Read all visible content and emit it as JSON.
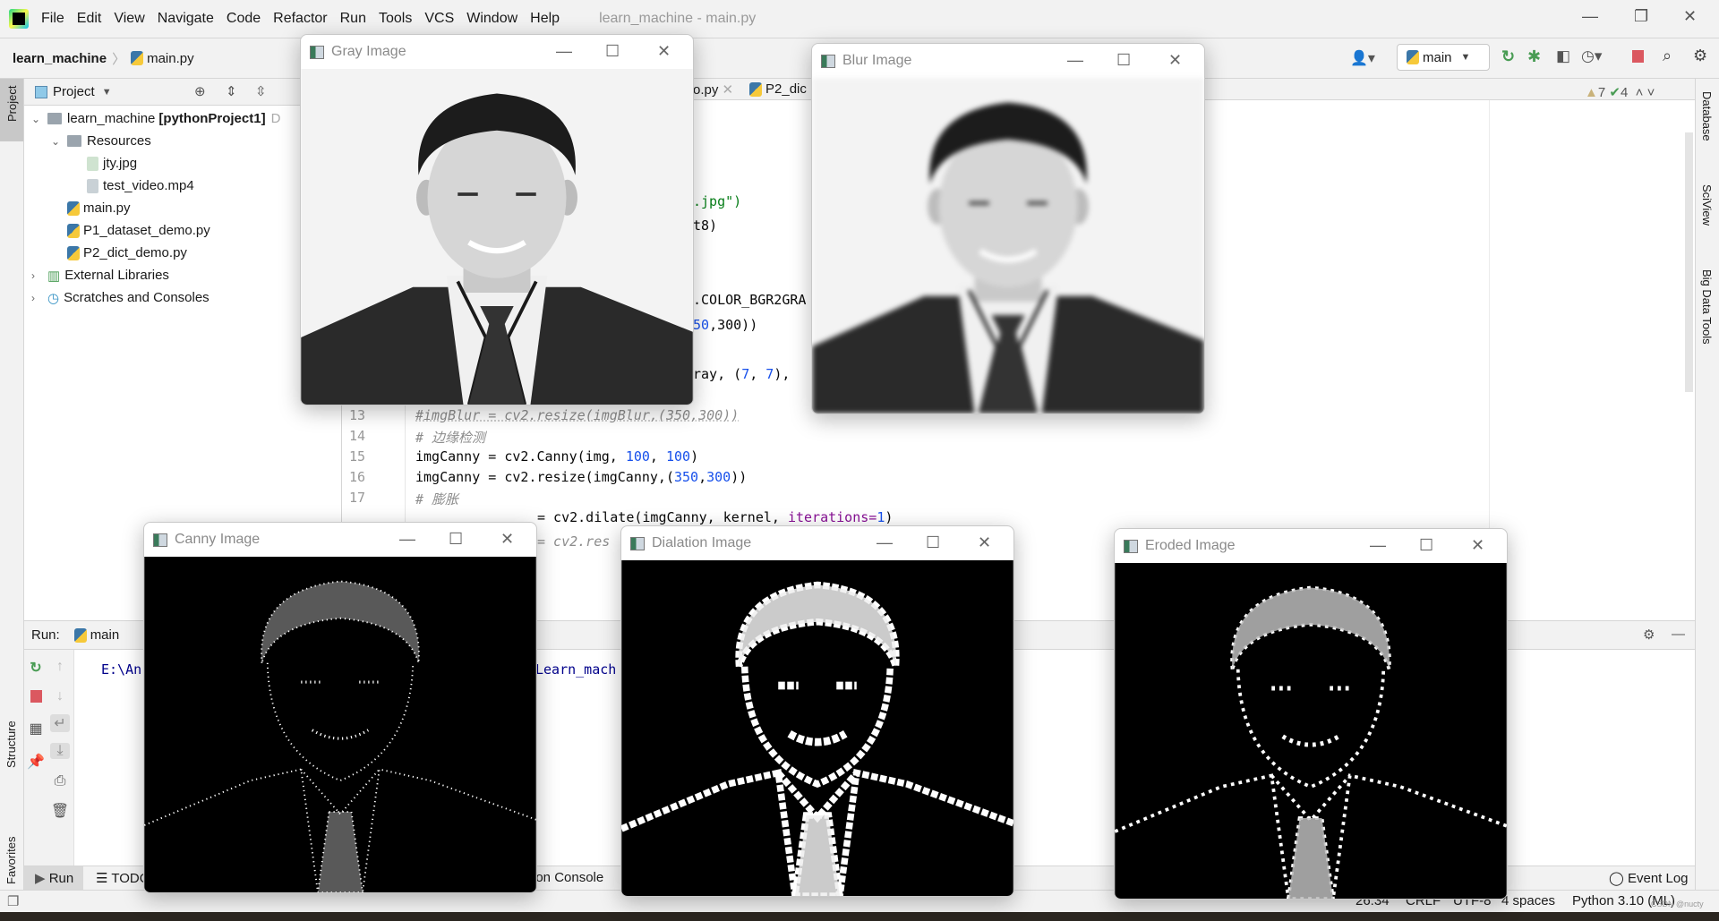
{
  "app": {
    "menu": [
      "File",
      "Edit",
      "View",
      "Navigate",
      "Code",
      "Refactor",
      "Run",
      "Tools",
      "VCS",
      "Window",
      "Help"
    ],
    "window_title": "learn_machine - main.py"
  },
  "nav": {
    "project": "learn_machine",
    "file": "main.py",
    "run_config": "main"
  },
  "project_panel": {
    "title": "Project",
    "tree": [
      {
        "label": "learn_machine",
        "suffix": "[pythonProject1]",
        "trail": "D",
        "type": "folder",
        "depth": 0,
        "expanded": true
      },
      {
        "label": "Resources",
        "type": "folder",
        "depth": 1,
        "expanded": true
      },
      {
        "label": "jty.jpg",
        "type": "image",
        "depth": 2
      },
      {
        "label": "test_video.mp4",
        "type": "unknown",
        "depth": 2
      },
      {
        "label": "main.py",
        "type": "python",
        "depth": 1
      },
      {
        "label": "P1_dataset_demo.py",
        "type": "python",
        "depth": 1
      },
      {
        "label": "P2_dict_demo.py",
        "type": "python",
        "depth": 1
      },
      {
        "label": "External Libraries",
        "type": "library",
        "depth": 0,
        "expanded": false
      },
      {
        "label": "Scratches and Consoles",
        "type": "scratch",
        "depth": 0,
        "expanded": false
      }
    ]
  },
  "editor": {
    "tabs": [
      {
        "label": "o.py"
      },
      {
        "label": "P2_dic"
      }
    ],
    "warnings": "7",
    "checks": "4",
    "fragments": {
      "l5": ".jpg\")",
      "l6": "t8)",
      "l9": ".COLOR_BGR2GRA",
      "l10a": "50",
      "l10b": ",300))",
      "l12a": "ray, (",
      "l12b": "7",
      ", ": ", ",
      "l12c": "7",
      "l12d": "), "
    },
    "line_numbers": [
      "13",
      "14",
      "15",
      "16",
      "17"
    ],
    "lines": {
      "l13": "#imgBlur = cv2.resize(imgBlur,(350,300))",
      "l14": "# 边缘检测",
      "l15a": "imgCanny = cv2.Canny(img, ",
      "l15b": "100",
      ", ": ", ",
      "l15c": "100",
      "l15d": ")",
      "l16a": "imgCanny = cv2.resize(imgCanny,(",
      "l16b": "350",
      "l16c": ",",
      "l16d": "300",
      "l16e": "))",
      "l17": "# 膨胀",
      "l18a": "= cv2.dilate(imgCanny, kernel, ",
      "l18b": "iterations=",
      "l18c": "1",
      ")": ")",
      "l19": "= cv2.res"
    }
  },
  "run": {
    "label": "Run:",
    "tab": "main",
    "console_a": "E:\\An",
    "console_b": "Learn_mach"
  },
  "bottom_tabs": {
    "run": "Run",
    "todo": "TODO",
    "python_console": "hon Console",
    "event_log": "Event Log"
  },
  "side": {
    "left": [
      "Project",
      "Structure",
      "Favorites"
    ],
    "right": [
      "Database",
      "SciView",
      "Big Data Tools"
    ]
  },
  "status": {
    "position": "26:34",
    "line_sep": "CRLF",
    "encoding": "UTF-8",
    "indent": "4 spaces",
    "interpreter": "Python 3.10 (ML)",
    "watermark": "CSDN @nucty"
  },
  "windows": [
    {
      "title": "Gray Image",
      "style": "gray"
    },
    {
      "title": "Blur Image",
      "style": "blur"
    },
    {
      "title": "Canny Image",
      "style": "canny"
    },
    {
      "title": "Dialation Image",
      "style": "dilate"
    },
    {
      "title": "Eroded Image",
      "style": "erode"
    }
  ],
  "colors": {
    "run_green": "#499c54",
    "stop_red": "#db5860",
    "keyword_blue": "#1750eb",
    "comment": "#8c8c8c"
  }
}
